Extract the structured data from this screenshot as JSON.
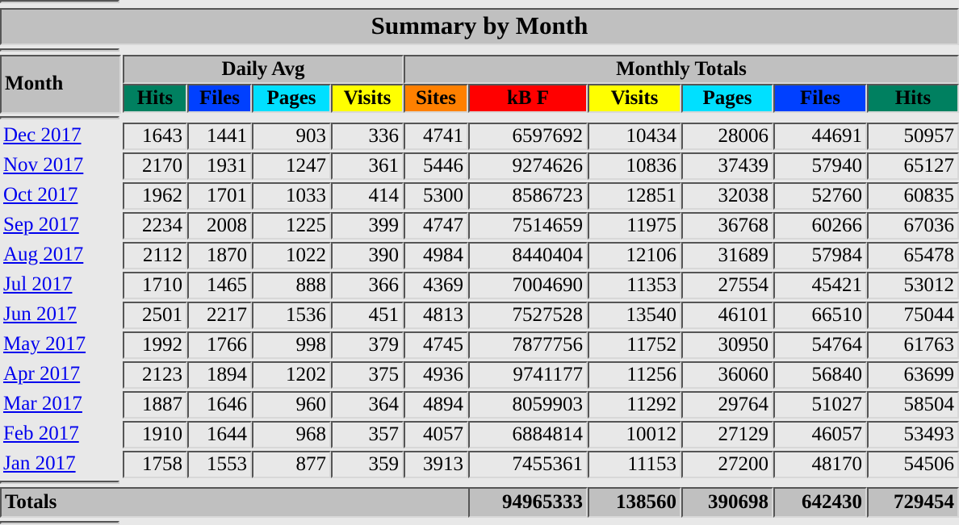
{
  "title": "Summary by Month",
  "headers": {
    "month": "Month",
    "daily_avg": "Daily Avg",
    "monthly_totals": "Monthly Totals",
    "columns": [
      {
        "label": "Hits",
        "color": "#008060"
      },
      {
        "label": "Files",
        "color": "#0040ff"
      },
      {
        "label": "Pages",
        "color": "#00e0ff"
      },
      {
        "label": "Visits",
        "color": "#ffff00"
      },
      {
        "label": "Sites",
        "color": "#ff8000"
      },
      {
        "label": "kB F",
        "color": "#ff0000"
      },
      {
        "label": "Visits",
        "color": "#ffff00"
      },
      {
        "label": "Pages",
        "color": "#00e0ff"
      },
      {
        "label": "Files",
        "color": "#0040ff"
      },
      {
        "label": "Hits",
        "color": "#008060"
      }
    ]
  },
  "rows": [
    {
      "month": "Dec 2017",
      "values": [
        "1643",
        "1441",
        "903",
        "336",
        "4741",
        "6597692",
        "10434",
        "28006",
        "44691",
        "50957"
      ]
    },
    {
      "month": "Nov 2017",
      "values": [
        "2170",
        "1931",
        "1247",
        "361",
        "5446",
        "9274626",
        "10836",
        "37439",
        "57940",
        "65127"
      ]
    },
    {
      "month": "Oct 2017",
      "values": [
        "1962",
        "1701",
        "1033",
        "414",
        "5300",
        "8586723",
        "12851",
        "32038",
        "52760",
        "60835"
      ]
    },
    {
      "month": "Sep 2017",
      "values": [
        "2234",
        "2008",
        "1225",
        "399",
        "4747",
        "7514659",
        "11975",
        "36768",
        "60266",
        "67036"
      ]
    },
    {
      "month": "Aug 2017",
      "values": [
        "2112",
        "1870",
        "1022",
        "390",
        "4984",
        "8440404",
        "12106",
        "31689",
        "57984",
        "65478"
      ]
    },
    {
      "month": "Jul 2017",
      "values": [
        "1710",
        "1465",
        "888",
        "366",
        "4369",
        "7004690",
        "11353",
        "27554",
        "45421",
        "53012"
      ]
    },
    {
      "month": "Jun 2017",
      "values": [
        "2501",
        "2217",
        "1536",
        "451",
        "4813",
        "7527528",
        "13540",
        "46101",
        "66510",
        "75044"
      ]
    },
    {
      "month": "May 2017",
      "values": [
        "1992",
        "1766",
        "998",
        "379",
        "4745",
        "7877756",
        "11752",
        "30950",
        "54764",
        "61763"
      ]
    },
    {
      "month": "Apr 2017",
      "values": [
        "2123",
        "1894",
        "1202",
        "375",
        "4936",
        "9741177",
        "11256",
        "36060",
        "56840",
        "63699"
      ]
    },
    {
      "month": "Mar 2017",
      "values": [
        "1887",
        "1646",
        "960",
        "364",
        "4894",
        "8059903",
        "11292",
        "29764",
        "51027",
        "58504"
      ]
    },
    {
      "month": "Feb 2017",
      "values": [
        "1910",
        "1644",
        "968",
        "357",
        "4057",
        "6884814",
        "10012",
        "27129",
        "46057",
        "53493"
      ]
    },
    {
      "month": "Jan 2017",
      "values": [
        "1758",
        "1553",
        "877",
        "359",
        "3913",
        "7455361",
        "11153",
        "27200",
        "48170",
        "54506"
      ]
    }
  ],
  "totals": {
    "label": "Totals",
    "values": [
      "94965333",
      "138560",
      "390698",
      "642430",
      "729454"
    ]
  }
}
